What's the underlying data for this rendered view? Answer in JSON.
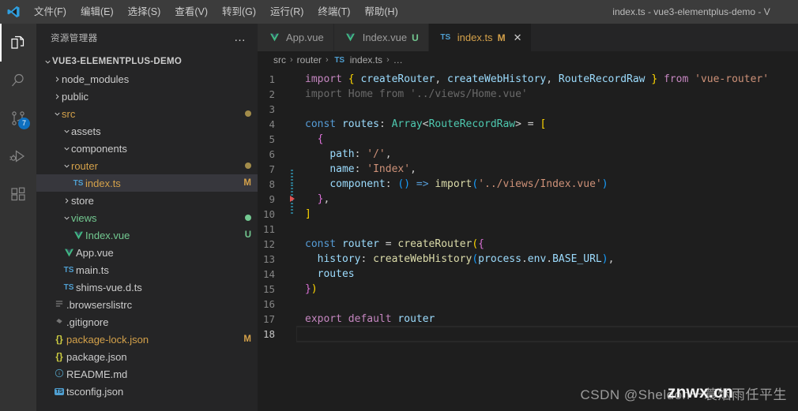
{
  "window": {
    "title": "index.ts - vue3-elementplus-demo - V",
    "logo_icon": "vscode-logo-icon"
  },
  "menu": {
    "items": [
      {
        "label": "文件(F)",
        "name": "menu-file"
      },
      {
        "label": "编辑(E)",
        "name": "menu-edit"
      },
      {
        "label": "选择(S)",
        "name": "menu-selection"
      },
      {
        "label": "查看(V)",
        "name": "menu-view"
      },
      {
        "label": "转到(G)",
        "name": "menu-go"
      },
      {
        "label": "运行(R)",
        "name": "menu-run"
      },
      {
        "label": "终端(T)",
        "name": "menu-terminal"
      },
      {
        "label": "帮助(H)",
        "name": "menu-help"
      }
    ]
  },
  "activitybar": {
    "items": [
      {
        "name": "activity-explorer",
        "icon": "files-icon",
        "active": true,
        "badge": ""
      },
      {
        "name": "activity-search",
        "icon": "search-icon",
        "active": false,
        "badge": ""
      },
      {
        "name": "activity-source-control",
        "icon": "source-control-icon",
        "active": false,
        "badge": "7"
      },
      {
        "name": "activity-run-debug",
        "icon": "run-debug-icon",
        "active": false,
        "badge": ""
      },
      {
        "name": "activity-extensions",
        "icon": "extensions-icon",
        "active": false,
        "badge": ""
      }
    ]
  },
  "sidebar": {
    "title": "资源管理器",
    "more_actions": "…",
    "root": {
      "label": "VUE3-ELEMENTPLUS-DEMO",
      "expanded": true
    },
    "tree": [
      {
        "label": "node_modules",
        "indent": 1,
        "kind": "folder",
        "expanded": false,
        "icon": "",
        "status": "",
        "dot": ""
      },
      {
        "label": "public",
        "indent": 1,
        "kind": "folder",
        "expanded": false,
        "icon": "",
        "status": "",
        "dot": ""
      },
      {
        "label": "src",
        "indent": 1,
        "kind": "folder",
        "expanded": true,
        "icon": "",
        "status": "",
        "dot": "#a28c4a",
        "color": "#d4a14a"
      },
      {
        "label": "assets",
        "indent": 2,
        "kind": "folder",
        "expanded": true,
        "icon": "",
        "status": "",
        "dot": ""
      },
      {
        "label": "components",
        "indent": 2,
        "kind": "folder",
        "expanded": true,
        "icon": "",
        "status": "",
        "dot": ""
      },
      {
        "label": "router",
        "indent": 2,
        "kind": "folder",
        "expanded": true,
        "icon": "",
        "status": "",
        "dot": "#a28c4a",
        "color": "#d4a14a"
      },
      {
        "label": "index.ts",
        "indent": 3,
        "kind": "file",
        "expanded": false,
        "icon": "ts-file-icon",
        "status": "M",
        "dot": "",
        "color": "#d4a14a",
        "selected": true
      },
      {
        "label": "store",
        "indent": 2,
        "kind": "folder",
        "expanded": false,
        "icon": "",
        "status": "",
        "dot": ""
      },
      {
        "label": "views",
        "indent": 2,
        "kind": "folder",
        "expanded": true,
        "icon": "",
        "status": "",
        "dot": "#73c991",
        "color": "#73c991"
      },
      {
        "label": "Index.vue",
        "indent": 3,
        "kind": "file",
        "expanded": false,
        "icon": "vue-file-icon",
        "status": "U",
        "dot": "",
        "color": "#73c991"
      },
      {
        "label": "App.vue",
        "indent": 2,
        "kind": "file",
        "expanded": false,
        "icon": "vue-file-icon",
        "status": "",
        "dot": ""
      },
      {
        "label": "main.ts",
        "indent": 2,
        "kind": "file",
        "expanded": false,
        "icon": "ts-file-icon",
        "status": "",
        "dot": ""
      },
      {
        "label": "shims-vue.d.ts",
        "indent": 2,
        "kind": "file",
        "expanded": false,
        "icon": "ts-file-icon",
        "status": "",
        "dot": ""
      },
      {
        "label": ".browserslistrc",
        "indent": 1,
        "kind": "file",
        "expanded": false,
        "icon": "config-file-icon",
        "status": "",
        "dot": ""
      },
      {
        "label": ".gitignore",
        "indent": 1,
        "kind": "file",
        "expanded": false,
        "icon": "git-file-icon",
        "status": "",
        "dot": ""
      },
      {
        "label": "package-lock.json",
        "indent": 1,
        "kind": "file",
        "expanded": false,
        "icon": "json-file-icon",
        "status": "M",
        "dot": "",
        "color": "#d4a14a"
      },
      {
        "label": "package.json",
        "indent": 1,
        "kind": "file",
        "expanded": false,
        "icon": "json-file-icon",
        "status": "",
        "dot": ""
      },
      {
        "label": "README.md",
        "indent": 1,
        "kind": "file",
        "expanded": false,
        "icon": "markdown-file-icon",
        "status": "",
        "dot": ""
      },
      {
        "label": "tsconfig.json",
        "indent": 1,
        "kind": "file",
        "expanded": false,
        "icon": "tsconfig-file-icon",
        "status": "",
        "dot": ""
      }
    ]
  },
  "editor": {
    "tabs": [
      {
        "label": "App.vue",
        "icon": "vue-file-icon",
        "badge": "",
        "active": false,
        "closable": false,
        "color": "#cccccc"
      },
      {
        "label": "Index.vue",
        "icon": "vue-file-icon",
        "badge": "U",
        "active": false,
        "closable": false,
        "color": "#73c991"
      },
      {
        "label": "index.ts",
        "icon": "ts-file-icon",
        "badge": "M",
        "active": true,
        "closable": true,
        "color": "#d4a14a"
      }
    ],
    "close_icon": "close-icon",
    "breadcrumb": [
      {
        "label": "src",
        "icon": ""
      },
      {
        "label": "router",
        "icon": ""
      },
      {
        "label": "index.ts",
        "icon": "ts-file-icon"
      },
      {
        "label": "…",
        "icon": ""
      }
    ],
    "breadcrumb_separator": "›",
    "lines": [
      {
        "n": "1",
        "gutter": "",
        "current": false,
        "tokens": [
          {
            "t": "import",
            "c": "t-kw"
          },
          {
            "t": " ",
            "c": "t-pun"
          },
          {
            "t": "{",
            "c": "t-br1"
          },
          {
            "t": " ",
            "c": "t-pun"
          },
          {
            "t": "createRouter",
            "c": "t-var"
          },
          {
            "t": ", ",
            "c": "t-pun"
          },
          {
            "t": "createWebHistory",
            "c": "t-var"
          },
          {
            "t": ", ",
            "c": "t-pun"
          },
          {
            "t": "RouteRecordRaw",
            "c": "t-var"
          },
          {
            "t": " ",
            "c": "t-pun"
          },
          {
            "t": "}",
            "c": "t-br1"
          },
          {
            "t": " ",
            "c": "t-pun"
          },
          {
            "t": "from",
            "c": "t-kw"
          },
          {
            "t": " ",
            "c": "t-pun"
          },
          {
            "t": "'vue-router'",
            "c": "t-str"
          }
        ]
      },
      {
        "n": "2",
        "gutter": "",
        "current": false,
        "tokens": [
          {
            "t": "import Home from '../views/Home.vue'",
            "c": "t-dim"
          }
        ]
      },
      {
        "n": "3",
        "gutter": "",
        "current": false,
        "tokens": []
      },
      {
        "n": "4",
        "gutter": "",
        "current": false,
        "tokens": [
          {
            "t": "const",
            "c": "t-const"
          },
          {
            "t": " ",
            "c": "t-pun"
          },
          {
            "t": "routes",
            "c": "t-var"
          },
          {
            "t": ": ",
            "c": "t-pun"
          },
          {
            "t": "Array",
            "c": "t-type"
          },
          {
            "t": "<",
            "c": "t-pun"
          },
          {
            "t": "RouteRecordRaw",
            "c": "t-type"
          },
          {
            "t": "> ",
            "c": "t-pun"
          },
          {
            "t": "=",
            "c": "t-pun"
          },
          {
            "t": " ",
            "c": "t-pun"
          },
          {
            "t": "[",
            "c": "t-br1"
          }
        ]
      },
      {
        "n": "5",
        "gutter": "",
        "current": false,
        "tokens": [
          {
            "t": "  ",
            "c": "t-pun"
          },
          {
            "t": "{",
            "c": "t-br2"
          }
        ]
      },
      {
        "n": "6",
        "gutter": "",
        "current": false,
        "tokens": [
          {
            "t": "    ",
            "c": "t-pun"
          },
          {
            "t": "path",
            "c": "t-var"
          },
          {
            "t": ": ",
            "c": "t-pun"
          },
          {
            "t": "'/'",
            "c": "t-str"
          },
          {
            "t": ",",
            "c": "t-pun"
          }
        ]
      },
      {
        "n": "7",
        "gutter": "mod",
        "current": false,
        "tokens": [
          {
            "t": "    ",
            "c": "t-pun"
          },
          {
            "t": "name",
            "c": "t-var"
          },
          {
            "t": ": ",
            "c": "t-pun"
          },
          {
            "t": "'Index'",
            "c": "t-str"
          },
          {
            "t": ",",
            "c": "t-pun"
          }
        ]
      },
      {
        "n": "8",
        "gutter": "mod",
        "current": false,
        "tokens": [
          {
            "t": "    ",
            "c": "t-pun"
          },
          {
            "t": "component",
            "c": "t-var"
          },
          {
            "t": ": ",
            "c": "t-pun"
          },
          {
            "t": "(",
            "c": "t-br3"
          },
          {
            "t": ")",
            "c": "t-br3"
          },
          {
            "t": " ",
            "c": "t-pun"
          },
          {
            "t": "=>",
            "c": "t-op"
          },
          {
            "t": " ",
            "c": "t-pun"
          },
          {
            "t": "import",
            "c": "t-fn"
          },
          {
            "t": "(",
            "c": "t-br3"
          },
          {
            "t": "'../views/Index.vue'",
            "c": "t-str"
          },
          {
            "t": ")",
            "c": "t-br3"
          }
        ]
      },
      {
        "n": "9",
        "gutter": "del",
        "current": false,
        "tokens": [
          {
            "t": "  ",
            "c": "t-pun"
          },
          {
            "t": "}",
            "c": "t-br2"
          },
          {
            "t": ",",
            "c": "t-pun"
          }
        ]
      },
      {
        "n": "10",
        "gutter": "",
        "current": false,
        "tokens": [
          {
            "t": "]",
            "c": "t-br1"
          }
        ]
      },
      {
        "n": "11",
        "gutter": "",
        "current": false,
        "tokens": []
      },
      {
        "n": "12",
        "gutter": "",
        "current": false,
        "tokens": [
          {
            "t": "const",
            "c": "t-const"
          },
          {
            "t": " ",
            "c": "t-pun"
          },
          {
            "t": "router",
            "c": "t-var"
          },
          {
            "t": " ",
            "c": "t-pun"
          },
          {
            "t": "=",
            "c": "t-pun"
          },
          {
            "t": " ",
            "c": "t-pun"
          },
          {
            "t": "createRouter",
            "c": "t-fn"
          },
          {
            "t": "(",
            "c": "t-br1"
          },
          {
            "t": "{",
            "c": "t-br2"
          }
        ]
      },
      {
        "n": "13",
        "gutter": "",
        "current": false,
        "tokens": [
          {
            "t": "  ",
            "c": "t-pun"
          },
          {
            "t": "history",
            "c": "t-var"
          },
          {
            "t": ": ",
            "c": "t-pun"
          },
          {
            "t": "createWebHistory",
            "c": "t-fn"
          },
          {
            "t": "(",
            "c": "t-br3"
          },
          {
            "t": "process",
            "c": "t-var"
          },
          {
            "t": ".",
            "c": "t-pun"
          },
          {
            "t": "env",
            "c": "t-var"
          },
          {
            "t": ".",
            "c": "t-pun"
          },
          {
            "t": "BASE_URL",
            "c": "t-var"
          },
          {
            "t": ")",
            "c": "t-br3"
          },
          {
            "t": ",",
            "c": "t-pun"
          }
        ]
      },
      {
        "n": "14",
        "gutter": "",
        "current": false,
        "tokens": [
          {
            "t": "  ",
            "c": "t-pun"
          },
          {
            "t": "routes",
            "c": "t-var"
          }
        ]
      },
      {
        "n": "15",
        "gutter": "",
        "current": false,
        "tokens": [
          {
            "t": "}",
            "c": "t-br2"
          },
          {
            "t": ")",
            "c": "t-br1"
          }
        ]
      },
      {
        "n": "16",
        "gutter": "",
        "current": false,
        "tokens": []
      },
      {
        "n": "17",
        "gutter": "",
        "current": false,
        "tokens": [
          {
            "t": "export",
            "c": "t-kw"
          },
          {
            "t": " ",
            "c": "t-pun"
          },
          {
            "t": "default",
            "c": "t-kw"
          },
          {
            "t": " ",
            "c": "t-pun"
          },
          {
            "t": "router",
            "c": "t-var"
          }
        ]
      },
      {
        "n": "18",
        "gutter": "",
        "current": true,
        "tokens": []
      }
    ]
  },
  "watermark": {
    "csdn": "CSDN @Sheldon一蓑烟雨任平生",
    "site": "znwx.cn"
  }
}
